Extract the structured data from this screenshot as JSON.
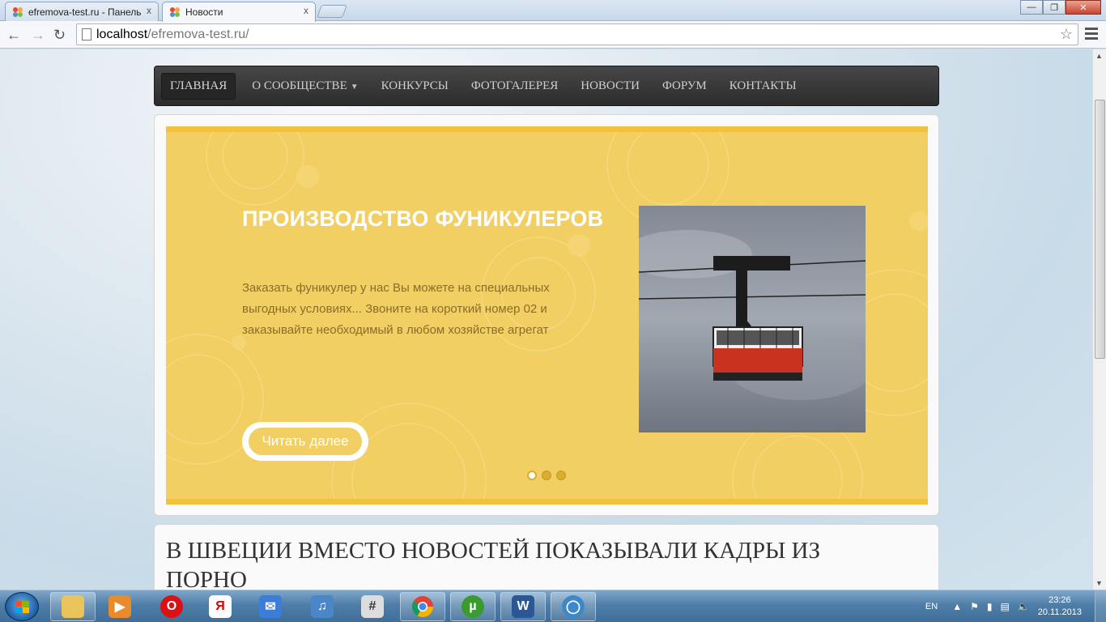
{
  "browser": {
    "tabs": [
      {
        "label": "efremova-test.ru - Панель",
        "active": false
      },
      {
        "label": "Новости",
        "active": true
      }
    ],
    "close_glyph": "x",
    "url_host": "localhost",
    "url_path": "/efremova-test.ru/",
    "window_buttons": {
      "minimize": "—",
      "maximize": "❐",
      "close": "✕"
    }
  },
  "site": {
    "nav": [
      {
        "label": "ГЛАВНАЯ",
        "active": true
      },
      {
        "label": "О СООБЩЕСТВЕ",
        "has_dropdown": true
      },
      {
        "label": "КОНКУРСЫ"
      },
      {
        "label": "ФОТОГАЛЕРЕЯ"
      },
      {
        "label": "НОВОСТИ"
      },
      {
        "label": "ФОРУМ"
      },
      {
        "label": "КОНТАКТЫ"
      }
    ],
    "slider": {
      "title": "ПРОИЗВОДСТВО ФУНИКУЛЕРОВ",
      "text": "Заказать фуникулер у нас Вы можете на специальных выгодных условиях... Звоните на короткий номер 02 и заказывайте необходимый в любом хозяйстве агрегат",
      "button": "Читать далее",
      "slide_count": 3,
      "active_slide": 1,
      "bg_color": "#f2cf63"
    },
    "article": {
      "title": "В ШВЕЦИИ ВМЕСТО НОВОСТЕЙ ПОКАЗЫВАЛИ КАДРЫ ИЗ ПОРНО"
    }
  },
  "taskbar": {
    "apps": [
      "explorer-icon",
      "media-player-icon",
      "opera-icon",
      "yandex-icon",
      "mail-icon",
      "volume-app-icon",
      "calculator-icon",
      "chrome-icon",
      "utorrent-icon",
      "word-icon",
      "network-globe-icon"
    ],
    "language": "EN",
    "time": "23:26",
    "date": "20.11.2013"
  }
}
